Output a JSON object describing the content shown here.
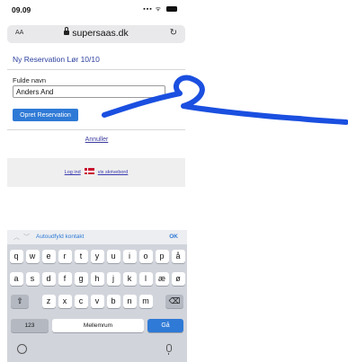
{
  "status_bar": {
    "time": "09.09",
    "signal": "▪▪▪ ᯤ"
  },
  "browser": {
    "text_size_label": "AA",
    "domain": "supersaas.dk",
    "reload_glyph": "↻"
  },
  "page": {
    "title": "Ny Reservation Lør 10/10",
    "field_label": "Fulde navn",
    "name_value": "Anders And",
    "submit_label": "Opret Reservation",
    "cancel_label": "Annuller"
  },
  "footer": {
    "login_label": "Log ind",
    "desktop_label": "vis skrivebord"
  },
  "keyboard": {
    "autofill_label": "Autoudfyld kontakt",
    "ok_label": "OK",
    "rows": [
      [
        "q",
        "w",
        "e",
        "r",
        "t",
        "y",
        "u",
        "i",
        "o",
        "p",
        "å"
      ],
      [
        "a",
        "s",
        "d",
        "f",
        "g",
        "h",
        "j",
        "k",
        "l",
        "æ",
        "ø"
      ],
      [
        "z",
        "x",
        "c",
        "v",
        "b",
        "n",
        "m"
      ]
    ],
    "shift_glyph": "⇧",
    "backspace_glyph": "⌫",
    "numbers_label": "123",
    "space_label": "Mellemrum",
    "go_label": "Gå"
  },
  "annotation": {
    "stroke_color": "#1a4fe0"
  }
}
